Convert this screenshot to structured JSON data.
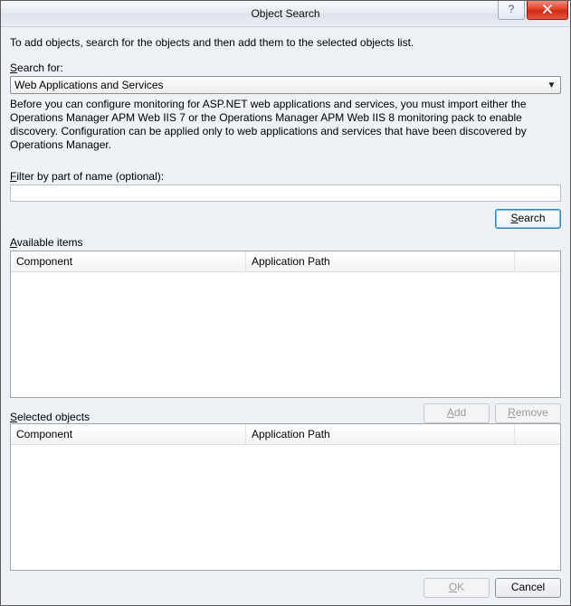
{
  "window": {
    "title": "Object Search",
    "help_glyph": "?"
  },
  "intro": "To add objects, search for the objects and then add them to the selected objects list.",
  "search_for": {
    "label": "Search for:",
    "selected": "Web Applications and Services"
  },
  "description": "Before you can configure monitoring for ASP.NET web applications and services, you must import either the Operations Manager APM Web IIS 7 or the Operations Manager APM Web IIS 8 monitoring pack to enable discovery. Configuration can be applied only to web applications and services that have been discovered by Operations Manager.",
  "filter": {
    "label": "Filter by part of name (optional):",
    "value": ""
  },
  "buttons": {
    "search": "Search",
    "add": "Add",
    "remove": "Remove",
    "ok": "OK",
    "cancel": "Cancel"
  },
  "available": {
    "label": "Available items",
    "columns": [
      "Component",
      "Application Path",
      ""
    ]
  },
  "selected": {
    "label": "Selected objects",
    "columns": [
      "Component",
      "Application Path",
      ""
    ]
  }
}
